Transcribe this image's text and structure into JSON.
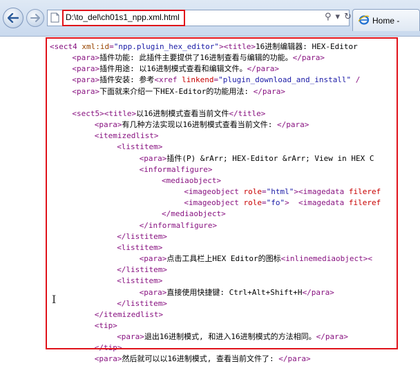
{
  "browser": {
    "address": "D:\\to_del\\ch01s1_npp.xml.html",
    "address_icons": [
      "search-icon",
      "dropdown-icon",
      "refresh-icon",
      "close-icon"
    ],
    "tab_label": "Home -",
    "accent_red": "#e0121a"
  },
  "lines": [
    {
      "indent": 0,
      "parts": [
        [
          "t",
          "<sect4 "
        ],
        [
          "a",
          "xml:id"
        ],
        [
          "t",
          "="
        ],
        [
          "s",
          "\"npp.plugin_hex_editor\""
        ],
        [
          "t",
          ">"
        ],
        [
          "t",
          "<title>"
        ],
        [
          "x",
          "16进制编辑器: HEX-Editor"
        ]
      ]
    },
    {
      "indent": 1,
      "parts": [
        [
          "t",
          "<para>"
        ],
        [
          "x",
          "插件功能: 此插件主要提供了16进制查看与编辑的功能。"
        ],
        [
          "t",
          "</para>"
        ]
      ]
    },
    {
      "indent": 1,
      "parts": [
        [
          "t",
          "<para>"
        ],
        [
          "x",
          "插件用途: 以16进制模式查看和编辑文件。"
        ],
        [
          "t",
          "</para>"
        ]
      ]
    },
    {
      "indent": 1,
      "parts": [
        [
          "t",
          "<para>"
        ],
        [
          "x",
          "插件安装: 参考"
        ],
        [
          "t",
          "<xref "
        ],
        [
          "r",
          "linkend"
        ],
        [
          "t",
          "="
        ],
        [
          "s",
          "\"plugin_download_and_install\""
        ],
        [
          "t",
          " /"
        ]
      ]
    },
    {
      "indent": 1,
      "parts": [
        [
          "t",
          "<para>"
        ],
        [
          "x",
          "下面就来介绍一下HEX-Editor的功能用法: "
        ],
        [
          "t",
          "</para>"
        ]
      ]
    },
    {
      "indent": 0,
      "parts": []
    },
    {
      "indent": 1,
      "parts": [
        [
          "t",
          "<sect5>"
        ],
        [
          "t",
          "<title>"
        ],
        [
          "x",
          "以16进制模式查看当前文件"
        ],
        [
          "t",
          "</title>"
        ]
      ]
    },
    {
      "indent": 2,
      "parts": [
        [
          "t",
          "<para>"
        ],
        [
          "x",
          "有几种方法实现以16进制模式查看当前文件: "
        ],
        [
          "t",
          "</para>"
        ]
      ]
    },
    {
      "indent": 2,
      "parts": [
        [
          "t",
          "<itemizedlist>"
        ]
      ]
    },
    {
      "indent": 3,
      "parts": [
        [
          "t",
          "<listitem>"
        ]
      ]
    },
    {
      "indent": 4,
      "parts": [
        [
          "t",
          "<para>"
        ],
        [
          "x",
          "插件(P) &rArr; HEX-Editor &rArr; View in HEX C"
        ]
      ]
    },
    {
      "indent": 4,
      "parts": [
        [
          "t",
          "<informalfigure>"
        ]
      ]
    },
    {
      "indent": 5,
      "parts": [
        [
          "t",
          "<mediaobject>"
        ]
      ]
    },
    {
      "indent": 6,
      "parts": [
        [
          "t",
          "<imageobject "
        ],
        [
          "r",
          "role"
        ],
        [
          "t",
          "="
        ],
        [
          "s",
          "\"html\""
        ],
        [
          "t",
          ">"
        ],
        [
          "t",
          "<imagedata "
        ],
        [
          "r",
          "fileref"
        ]
      ]
    },
    {
      "indent": 6,
      "parts": [
        [
          "t",
          "<imageobject "
        ],
        [
          "r",
          "role"
        ],
        [
          "t",
          "="
        ],
        [
          "s",
          "\"fo\""
        ],
        [
          "t",
          ">  "
        ],
        [
          "t",
          "<imagedata "
        ],
        [
          "r",
          "fileref"
        ]
      ]
    },
    {
      "indent": 5,
      "parts": [
        [
          "t",
          "</mediaobject>"
        ]
      ]
    },
    {
      "indent": 4,
      "parts": [
        [
          "t",
          "</informalfigure>"
        ]
      ]
    },
    {
      "indent": 3,
      "parts": [
        [
          "t",
          "</listitem>"
        ]
      ]
    },
    {
      "indent": 3,
      "parts": [
        [
          "t",
          "<listitem>"
        ]
      ]
    },
    {
      "indent": 4,
      "parts": [
        [
          "t",
          "<para>"
        ],
        [
          "x",
          "点击工具栏上HEX Editor的图标"
        ],
        [
          "t",
          "<inlinemediaobject><"
        ]
      ]
    },
    {
      "indent": 3,
      "parts": [
        [
          "t",
          "</listitem>"
        ]
      ]
    },
    {
      "indent": 3,
      "parts": [
        [
          "t",
          "<listitem>"
        ]
      ]
    },
    {
      "indent": 4,
      "parts": [
        [
          "t",
          "<para>"
        ],
        [
          "x",
          "直接使用快捷键: Ctrl+Alt+Shift+H"
        ],
        [
          "t",
          "</para>"
        ]
      ]
    },
    {
      "indent": 3,
      "parts": [
        [
          "t",
          "</listitem>"
        ]
      ]
    },
    {
      "indent": 2,
      "parts": [
        [
          "t",
          "</itemizedlist>"
        ]
      ]
    },
    {
      "indent": 2,
      "parts": [
        [
          "t",
          "<tip>"
        ]
      ]
    },
    {
      "indent": 3,
      "parts": [
        [
          "t",
          "<para>"
        ],
        [
          "x",
          "退出16进制模式, 和进入16进制模式的方法相同。"
        ],
        [
          "t",
          "</para>"
        ]
      ]
    },
    {
      "indent": 2,
      "parts": [
        [
          "t",
          "</tip>"
        ]
      ]
    },
    {
      "indent": 2,
      "parts": [
        [
          "t",
          "<para>"
        ],
        [
          "x",
          "然后就可以以16进制模式, 查看当前文件了: "
        ],
        [
          "t",
          "</para>"
        ]
      ]
    }
  ]
}
